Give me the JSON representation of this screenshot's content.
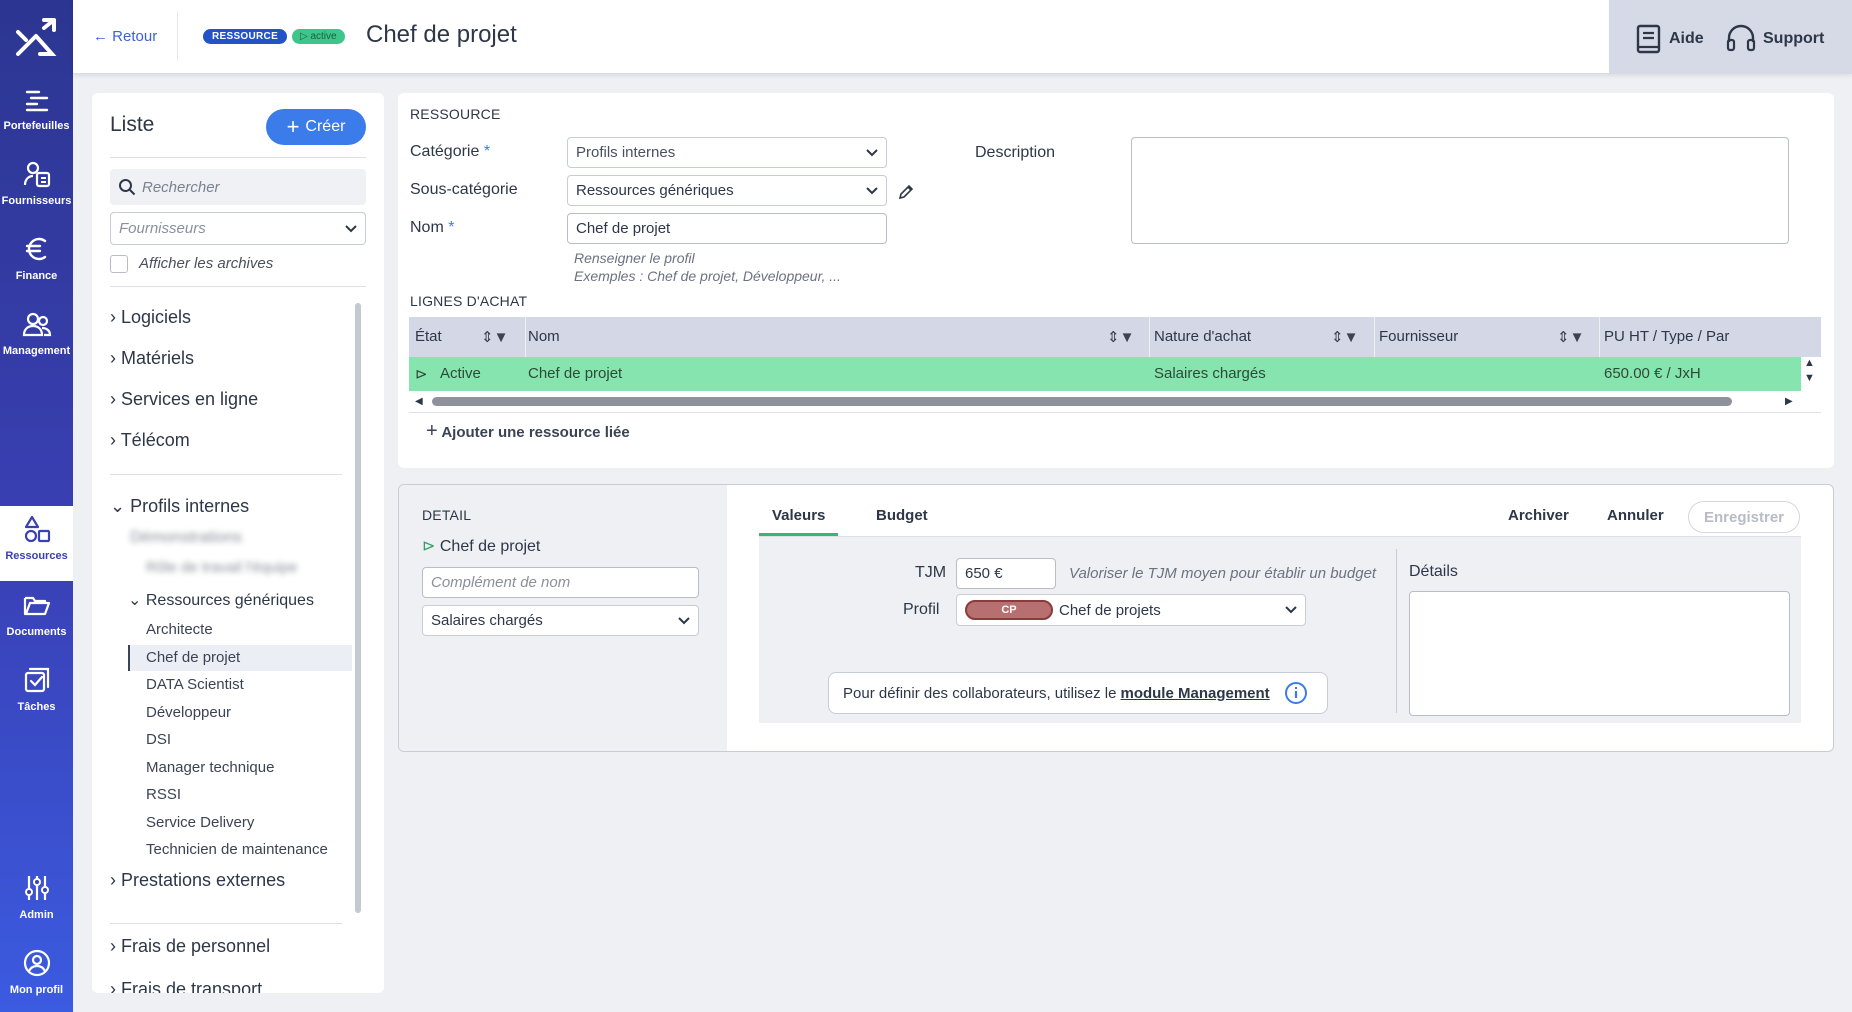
{
  "nav": {
    "items": [
      {
        "label": "Portefeuilles",
        "icon": "portfolio-icon"
      },
      {
        "label": "Fournisseurs",
        "icon": "suppliers-icon"
      },
      {
        "label": "Finance",
        "icon": "euro-icon"
      },
      {
        "label": "Management",
        "icon": "team-icon"
      },
      {
        "label": "Ressources",
        "icon": "shapes-icon"
      },
      {
        "label": "Documents",
        "icon": "folder-icon"
      },
      {
        "label": "Tâches",
        "icon": "tasks-icon"
      },
      {
        "label": "Admin",
        "icon": "sliders-icon"
      },
      {
        "label": "Mon profil",
        "icon": "user-icon"
      }
    ]
  },
  "header": {
    "back_label": "Retour",
    "type_badge": "RESSOURCE",
    "status_badge": "active",
    "title": "Chef de projet",
    "help_label": "Aide",
    "support_label": "Support"
  },
  "list": {
    "title": "Liste",
    "create_label": "Créer",
    "search_placeholder": "Rechercher",
    "supplier_placeholder": "Fournisseurs",
    "archive_label": "Afficher les archives",
    "categories": [
      "Logiciels",
      "Matériels",
      "Services en ligne",
      "Télécom",
      "Profils internes",
      "Prestations externes",
      "Frais de personnel",
      "Frais de transport"
    ],
    "blurred_1": "Démonstrations",
    "blurred_2": "Rôle de travail l'équipe",
    "subgroup": "Ressources génériques",
    "subitems": [
      "Architecte",
      "Chef de projet",
      "DATA Scientist",
      "Développeur",
      "DSI",
      "Manager technique",
      "RSSI",
      "Service Delivery",
      "Technicien de maintenance"
    ]
  },
  "ressource": {
    "section_title": "RESSOURCE",
    "category_label": "Catégorie",
    "category_value": "Profils internes",
    "subcategory_label": "Sous-catégorie",
    "subcategory_value": "Ressources génériques",
    "name_label": "Nom",
    "name_value": "Chef de projet",
    "hint_1": "Renseigner le profil",
    "hint_2": "Exemples : Chef de projet, Développeur, ...",
    "description_label": "Description",
    "required_mark": "*"
  },
  "purchase": {
    "section_title": "LIGNES D'ACHAT",
    "columns": [
      "État",
      "Nom",
      "Nature d'achat",
      "Fournisseur",
      "PU HT / Type / Par"
    ],
    "row": {
      "state": "Active",
      "name": "Chef de projet",
      "nature": "Salaires chargés",
      "supplier": "",
      "price": "650.00 € / JxH"
    },
    "add_label": "Ajouter une ressource liée"
  },
  "detail": {
    "section_title": "DETAIL",
    "name": "Chef de projet",
    "complement_placeholder": "Complément de nom",
    "nature_value": "Salaires chargés",
    "tabs": [
      "Valeurs",
      "Budget"
    ],
    "archive_label": "Archiver",
    "cancel_label": "Annuler",
    "save_label": "Enregistrer",
    "tjm_label": "TJM",
    "tjm_value": "650 €",
    "tjm_hint": "Valoriser le TJM moyen pour établir un budget",
    "profile_label": "Profil",
    "profile_badge": "CP",
    "profile_value": "Chef de projets",
    "info_text": "Pour définir des collaborateurs, utilisez le",
    "info_link": "module Management",
    "details_label": "Détails"
  },
  "colors": {
    "accent": "#3b7bea",
    "nav": "#3a40b5",
    "active_row": "#86e5ae",
    "active_badge": "#3dc58c",
    "resource_badge": "#2353c6"
  }
}
